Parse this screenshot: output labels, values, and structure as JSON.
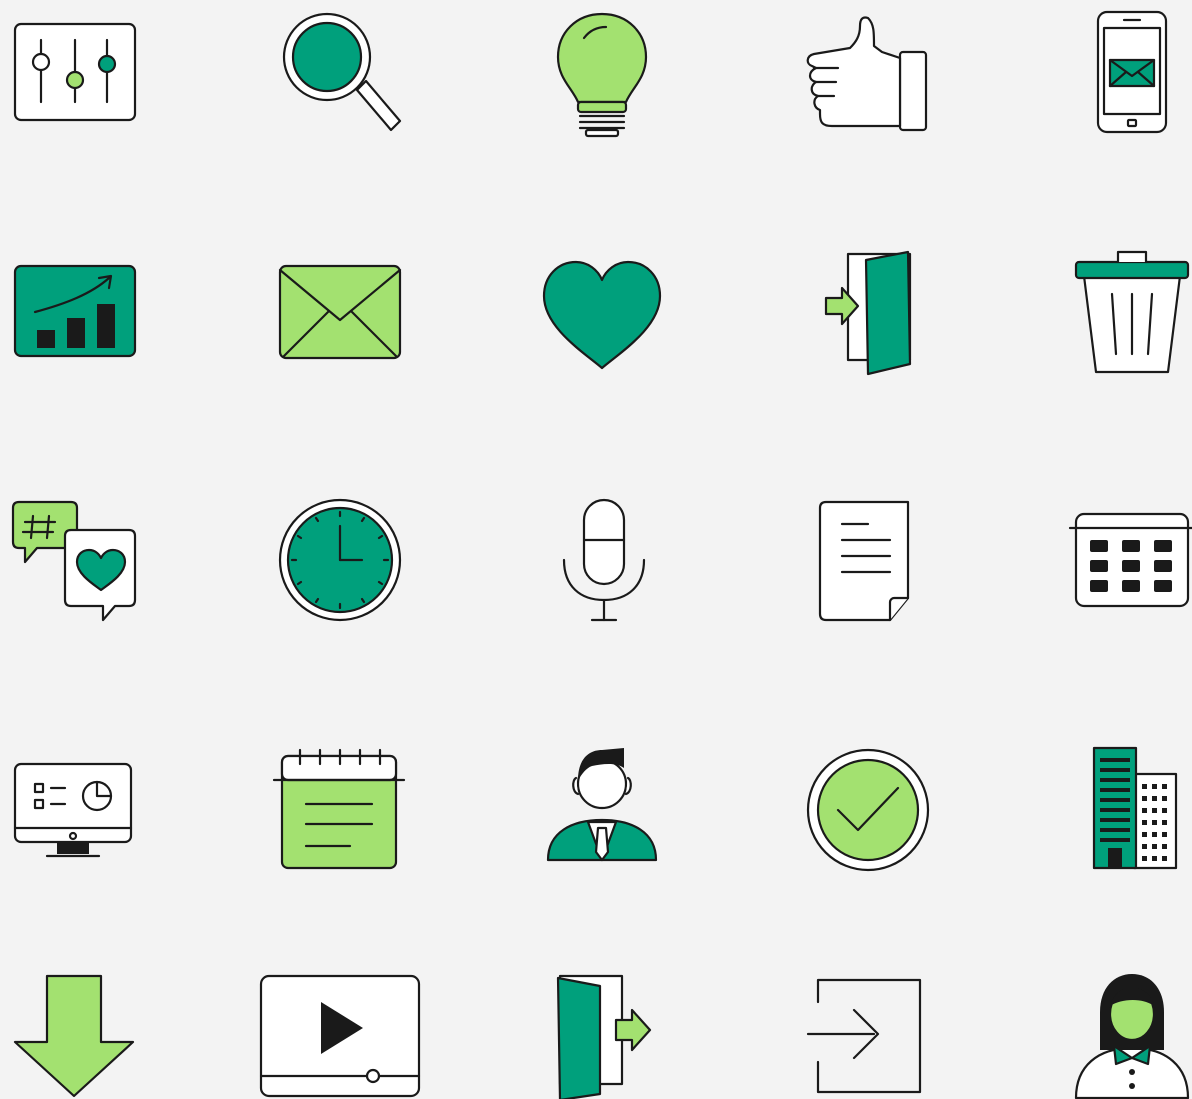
{
  "colors": {
    "background": "#f3f3f3",
    "outline": "#1a1a1a",
    "teal": "#00a07c",
    "lime": "#a3e170",
    "white": "#ffffff"
  },
  "icons": [
    [
      "sliders-icon",
      "magnifier-icon",
      "lightbulb-icon",
      "thumbs-up-icon",
      "phone-mail-icon"
    ],
    [
      "growth-chart-icon",
      "envelope-icon",
      "heart-icon",
      "door-enter-icon",
      "trash-can-icon"
    ],
    [
      "social-chat-icon",
      "clock-icon",
      "microphone-icon",
      "document-icon",
      "calendar-grid-icon"
    ],
    [
      "monitor-dashboard-icon",
      "notepad-icon",
      "businessman-icon",
      "checkmark-circle-icon",
      "buildings-icon"
    ],
    [
      "download-arrow-icon",
      "video-player-icon",
      "door-exit-icon",
      "sign-in-icon",
      "businesswoman-icon"
    ]
  ]
}
